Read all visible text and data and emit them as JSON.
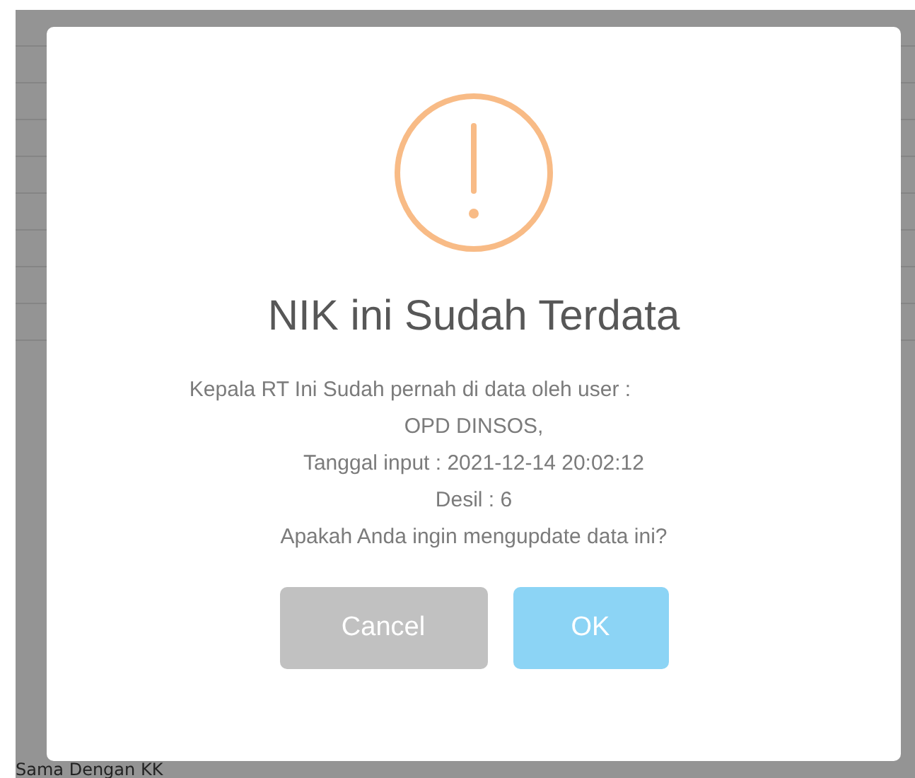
{
  "page": {
    "footer_text": "Sama Dengan KK"
  },
  "dialog": {
    "title": "NIK ini Sudah Terdata",
    "message_lines": [
      "Kepala RT Ini Sudah pernah di data oleh user :",
      "OPD DINSOS,",
      "Tanggal input : 2021-12-14 20:02:12",
      "Desil : 6",
      "Apakah Anda ingin mengupdate data ini?"
    ],
    "buttons": [
      {
        "label": "Cancel",
        "kind": "cancel"
      },
      {
        "label": "OK",
        "kind": "confirm"
      }
    ]
  }
}
